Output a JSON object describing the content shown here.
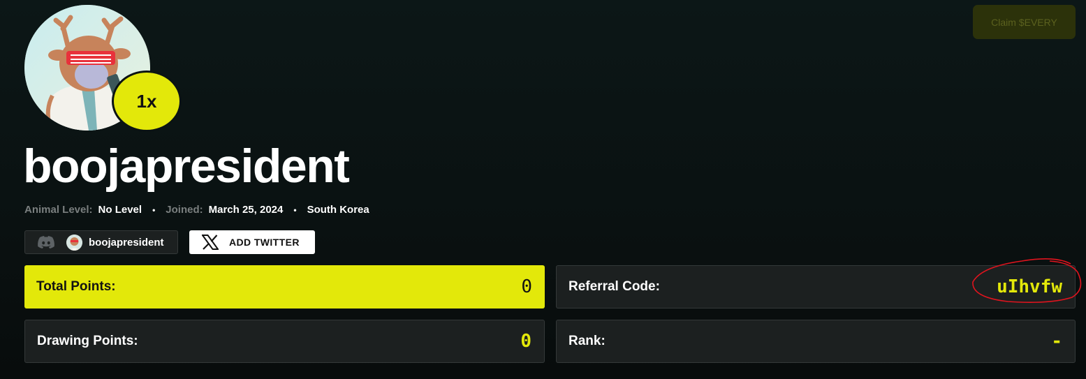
{
  "header": {
    "claim_label": "Claim $EVERY"
  },
  "profile": {
    "username": "boojapresident",
    "multiplier": "1x",
    "animal_level_label": "Animal Level:",
    "animal_level_value": "No Level",
    "joined_label": "Joined:",
    "joined_value": "March 25, 2024",
    "location": "South Korea"
  },
  "socials": {
    "discord_name": "boojapresident",
    "twitter_label": "ADD TWITTER"
  },
  "stats": {
    "total_points_label": "Total Points:",
    "total_points_value": "0",
    "referral_label": "Referral Code:",
    "referral_value": "uIhvfw",
    "drawing_points_label": "Drawing Points:",
    "drawing_points_value": "0",
    "rank_label": "Rank:",
    "rank_value": "-"
  },
  "colors": {
    "accent": "#e3e80a",
    "background": "#0b1313",
    "card": "#1c2020",
    "annotation": "#e0141e"
  },
  "icons": [
    "discord-icon",
    "x-icon"
  ]
}
